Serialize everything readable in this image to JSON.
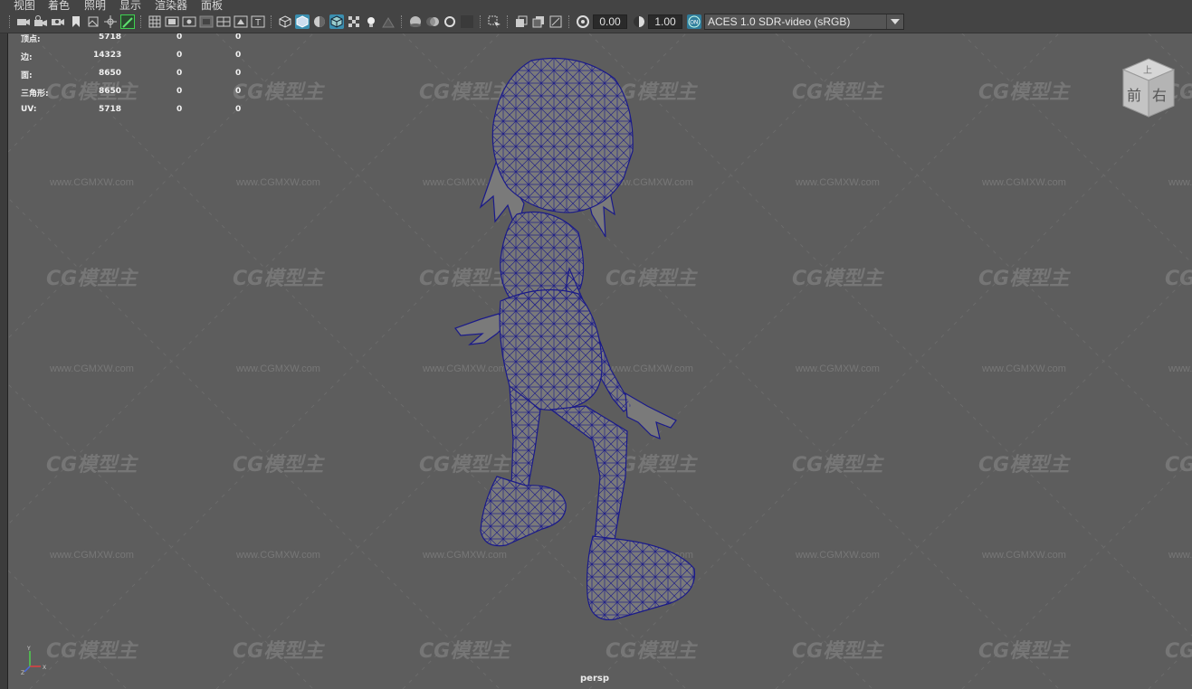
{
  "menu": [
    "视图",
    "着色",
    "照明",
    "显示",
    "渲染器",
    "面板"
  ],
  "toolbar": {
    "exposure_value": "0.00",
    "gamma_value": "1.00",
    "color_management_badge": "ON",
    "color_space": "ACES 1.0 SDR-video (sRGB)"
  },
  "hud": {
    "rows": [
      {
        "label": "顶点:",
        "value": "5718",
        "col2": "0",
        "col3": "0"
      },
      {
        "label": "边:",
        "value": "14323",
        "col2": "0",
        "col3": "0"
      },
      {
        "label": "面:",
        "value": "8650",
        "col2": "0",
        "col3": "0"
      },
      {
        "label": "三角形:",
        "value": "8650",
        "col2": "0",
        "col3": "0"
      },
      {
        "label": "UV:",
        "value": "5718",
        "col2": "0",
        "col3": "0"
      }
    ]
  },
  "viewcube": {
    "top": "上",
    "front": "前",
    "right": "右"
  },
  "camera_label": "persp",
  "axis": {
    "y": "Y",
    "x": "X",
    "z": "Z"
  },
  "watermark": {
    "logo": "CG模型主",
    "url": "www.CGMXW.com"
  },
  "colors": {
    "viewport_bg": "#5d5d5d",
    "wireframe": "#1a1a8a",
    "mesh_fill": "#7a7a7a",
    "active_tool": "#2e8a3c",
    "shading_active": "#3b8fb0"
  }
}
